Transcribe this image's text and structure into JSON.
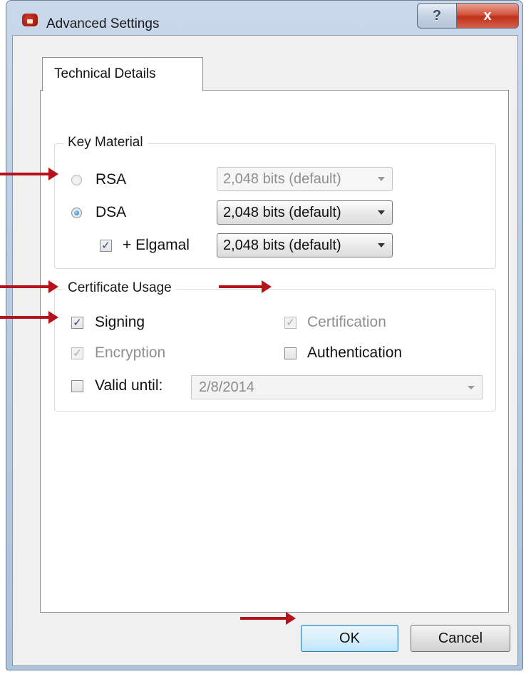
{
  "window": {
    "title": "Advanced Settings",
    "help_symbol": "?",
    "close_symbol": "x"
  },
  "tab": {
    "label": "Technical Details"
  },
  "key_material": {
    "title": "Key Material",
    "rsa": {
      "label": "RSA",
      "selected": false,
      "enabled": false,
      "size": "2,048 bits (default)"
    },
    "dsa": {
      "label": "DSA",
      "selected": true,
      "enabled": true,
      "size": "2,048 bits (default)"
    },
    "elgamal": {
      "label": "+ Elgamal",
      "checked": true,
      "size": "2,048 bits (default)"
    }
  },
  "certificate_usage": {
    "title": "Certificate Usage",
    "signing": {
      "label": "Signing",
      "checked": true,
      "enabled": true
    },
    "certification": {
      "label": "Certification",
      "checked": true,
      "enabled": false
    },
    "encryption": {
      "label": "Encryption",
      "checked": true,
      "enabled": false
    },
    "authentication": {
      "label": "Authentication",
      "checked": false,
      "enabled": true
    },
    "valid_until": {
      "label": "Valid until:",
      "checked": false,
      "date": "2/8/2014"
    }
  },
  "buttons": {
    "ok": "OK",
    "cancel": "Cancel"
  },
  "annotation_color": "#b5121b"
}
